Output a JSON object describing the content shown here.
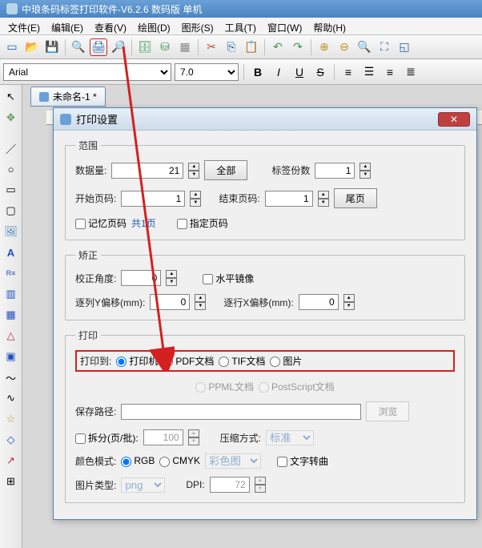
{
  "app": {
    "title": "中琅条码标签打印软件-V6.2.6 数码版 单机",
    "doc_name": "未命名-1 *"
  },
  "menu": {
    "file": "文件(E)",
    "edit": "编辑(E)",
    "view": "查看(V)",
    "draw": "绘图(D)",
    "shape": "图形(S)",
    "tool": "工具(T)",
    "window": "窗口(W)",
    "help": "帮助(H)"
  },
  "format": {
    "font": "Arial",
    "size": "7.0",
    "bold": "B",
    "italic": "I",
    "underline": "U",
    "strike": "S"
  },
  "dialog": {
    "title": "打印设置",
    "range": {
      "legend": "范围",
      "data_qty_lbl": "数据量:",
      "data_qty_val": "21",
      "btn_all": "全部",
      "label_copies_lbl": "标签份数",
      "label_copies_val": "1",
      "start_page_lbl": "开始页码:",
      "start_page_val": "1",
      "end_page_lbl": "结束页码:",
      "end_page_val": "1",
      "btn_last": "尾页",
      "remember_lbl": "记忆页码",
      "total_pages": "共1页",
      "specify_lbl": "指定页码"
    },
    "correct": {
      "legend": "矫正",
      "angle_lbl": "校正角度:",
      "angle_val": "0",
      "mirror_lbl": "水平镜像",
      "col_offset_lbl": "逐列Y偏移(mm):",
      "col_offset_val": "0",
      "row_offset_lbl": "逐行X偏移(mm):",
      "row_offset_val": "0"
    },
    "print": {
      "legend": "打印",
      "print_to_lbl": "打印到:",
      "opt_printer": "打印机",
      "opt_pdf": "PDF文档",
      "opt_tif": "TIF文档",
      "opt_img": "图片",
      "opt_ppml": "PPML文档",
      "opt_ps": "PostScript文档",
      "save_path_lbl": "保存路径:",
      "btn_browse": "浏览",
      "split_lbl": "拆分(页/批):",
      "split_val": "100",
      "compress_lbl": "压缩方式:",
      "compress_val": "标准",
      "color_lbl": "颜色模式:",
      "color_rgb": "RGB",
      "color_cmyk": "CMYK",
      "color_combo": "彩色图",
      "text_curve_lbl": "文字转曲",
      "img_type_lbl": "图片类型:",
      "img_type_val": "png",
      "dpi_lbl": "DPI:",
      "dpi_val": "72"
    }
  }
}
